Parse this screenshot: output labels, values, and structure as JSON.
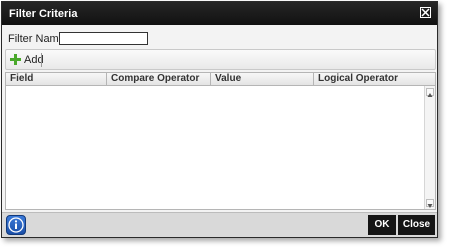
{
  "dialog": {
    "title": "Filter Criteria",
    "filter_name_label": "Filter Name:",
    "filter_name_value": ""
  },
  "toolbar": {
    "add_label": "Add"
  },
  "grid": {
    "columns": [
      "Field",
      "Compare Operator",
      "Value",
      "Logical Operator"
    ],
    "rows": []
  },
  "footer": {
    "ok_label": "OK",
    "close_label": "Close"
  },
  "icons": {
    "close": "close-icon",
    "add": "plus-icon",
    "info": "info-icon"
  },
  "colors": {
    "titlebar": "#1a1a1a",
    "button": "#151515",
    "info": "#2a63c4",
    "add_icon": "#4aa82b"
  }
}
